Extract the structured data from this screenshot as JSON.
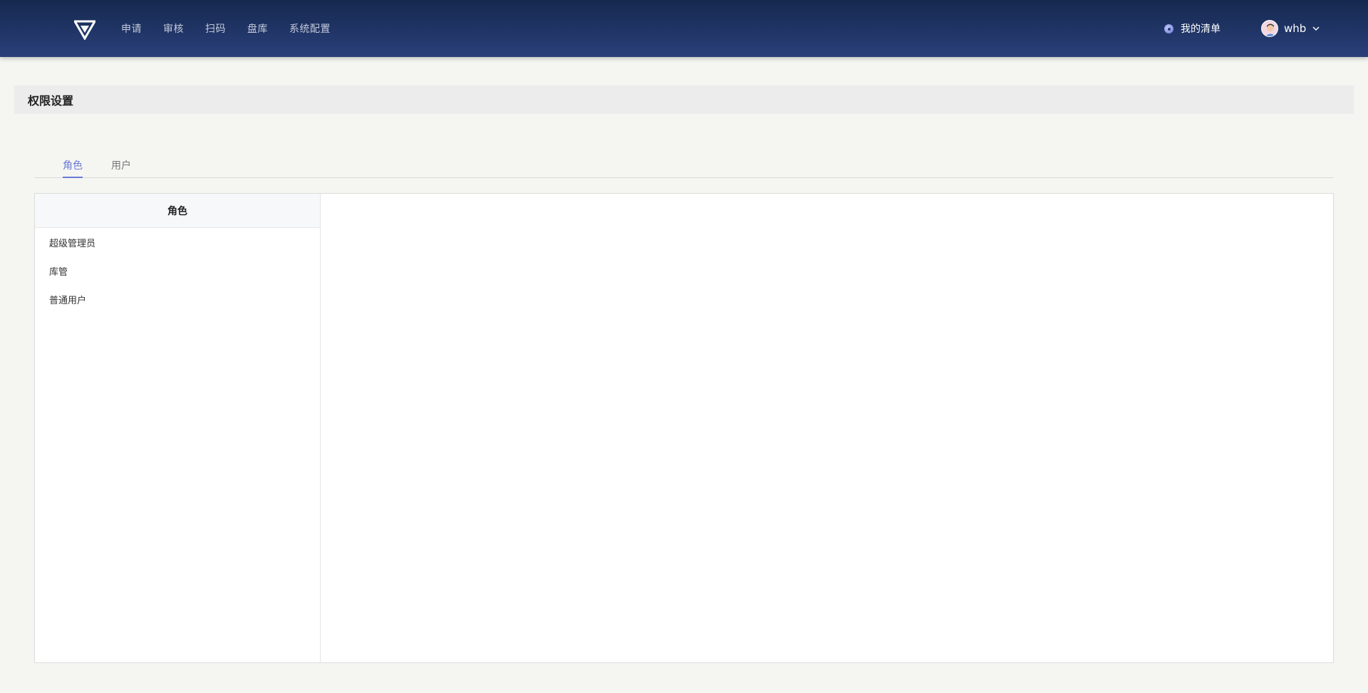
{
  "nav": {
    "items": [
      {
        "label": "申请"
      },
      {
        "label": "审核"
      },
      {
        "label": "扫码"
      },
      {
        "label": "盘库"
      },
      {
        "label": "系统配置"
      }
    ]
  },
  "header_right": {
    "my_list_label": "我的清单",
    "username": "whb"
  },
  "page": {
    "title": "权限设置"
  },
  "tabs": [
    {
      "label": "角色",
      "active": true
    },
    {
      "label": "用户",
      "active": false
    }
  ],
  "roles_panel": {
    "header": "角色",
    "items": [
      {
        "label": "超级管理员"
      },
      {
        "label": "库管"
      },
      {
        "label": "普通用户"
      }
    ]
  },
  "colors": {
    "accent": "#6b7bd6",
    "topbar_start": "#15294f",
    "topbar_end": "#2a3f7a"
  },
  "icons": {
    "logo": "triangle-logo-icon",
    "my_list": "circle-dot-icon",
    "avatar": "user-avatar",
    "dropdown": "chevron-down-icon"
  }
}
